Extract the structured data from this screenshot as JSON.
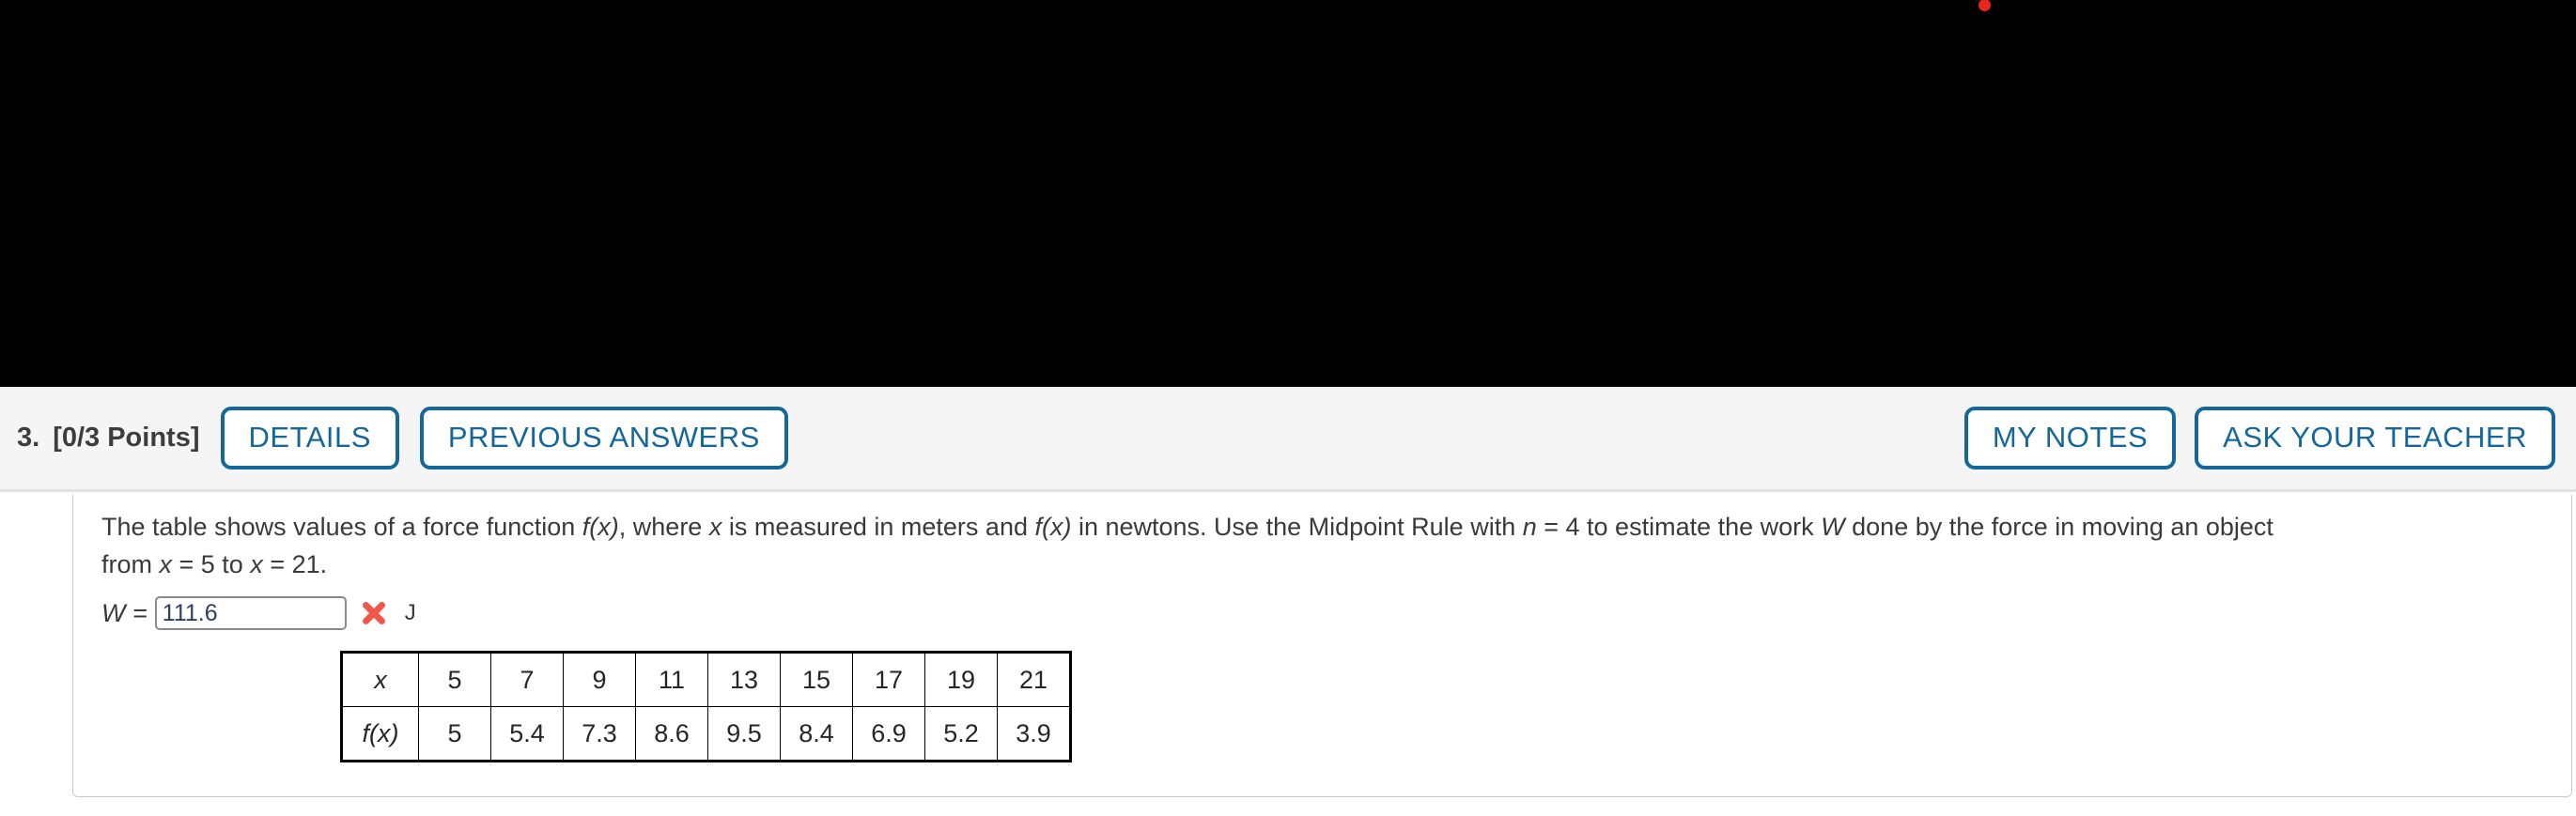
{
  "header": {
    "question_number": "3.",
    "points": "[0/3 Points]",
    "details_label": "DETAILS",
    "previous_answers_label": "PREVIOUS ANSWERS",
    "my_notes_label": "MY NOTES",
    "ask_your_teacher_label": "ASK YOUR TEACHER",
    "accent_color": "#14679b",
    "bar_color": "#f5f5f5"
  },
  "cursor": {
    "color": "#e8261c"
  },
  "problem": {
    "line1_part1": "The table shows values of a force function ",
    "line1_fx1": "f(x)",
    "line1_part2": ", where ",
    "line1_var_x": "x",
    "line1_part3": " is measured in meters and ",
    "line1_fx2": "f(x)",
    "line1_part4": " in newtons. Use the Midpoint Rule with ",
    "line1_var_n": "n",
    "line1_part5": " = 4 to estimate the work ",
    "line1_var_W": "W",
    "line1_part6": " done by the force in moving an object",
    "line2_part1": "from ",
    "line2_var_x1": "x",
    "line2_part2": " = 5 to ",
    "line2_var_x2": "x",
    "line2_part3": " = 21."
  },
  "answer": {
    "label": "W =",
    "value": "111.6",
    "placeholder": "",
    "unit": "J",
    "status_icon": "wrong-x-icon",
    "status_color": "#f0564a"
  },
  "chart_data": {
    "type": "table",
    "title": "",
    "row_headers": [
      "x",
      "f(x)"
    ],
    "x": [
      5,
      7,
      9,
      11,
      13,
      15,
      17,
      19,
      21
    ],
    "fx": [
      5,
      5.4,
      7.3,
      8.6,
      9.5,
      8.4,
      6.9,
      5.2,
      3.9
    ],
    "x_display": [
      "5",
      "7",
      "9",
      "11",
      "13",
      "15",
      "17",
      "19",
      "21"
    ],
    "fx_display": [
      "5",
      "5.4",
      "7.3",
      "8.6",
      "9.5",
      "8.4",
      "6.9",
      "5.2",
      "3.9"
    ],
    "xlabel": "x",
    "ylabel": "f(x)"
  }
}
